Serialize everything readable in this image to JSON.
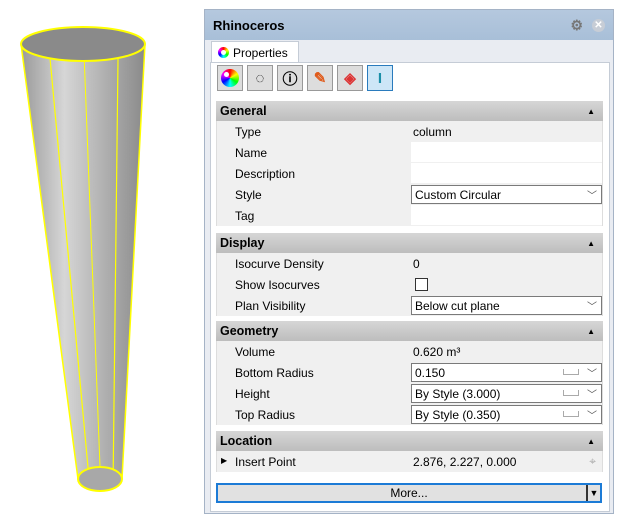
{
  "window": {
    "title": "Rhinoceros",
    "tab": "Properties"
  },
  "toolbar_icons": [
    "material-icon",
    "render-mesh-icon",
    "info-icon",
    "paint-tube-icon",
    "texture-mapping-icon",
    "column-icon"
  ],
  "sections": {
    "general": {
      "title": "General",
      "type_label": "Type",
      "type_value": "column",
      "name_label": "Name",
      "name_value": "",
      "desc_label": "Description",
      "desc_value": "",
      "style_label": "Style",
      "style_value": "Custom Circular",
      "tag_label": "Tag",
      "tag_value": ""
    },
    "display": {
      "title": "Display",
      "iso_label": "Isocurve Density",
      "iso_value": "0",
      "show_label": "Show Isocurves",
      "show_checked": false,
      "plan_label": "Plan Visibility",
      "plan_value": "Below cut plane"
    },
    "geometry": {
      "title": "Geometry",
      "volume_label": "Volume",
      "volume_value": "0.620 m³",
      "bottom_label": "Bottom Radius",
      "bottom_value": "0.150",
      "height_label": "Height",
      "height_value": "By Style (3.000)",
      "top_label": "Top Radius",
      "top_value": "By Style (0.350)"
    },
    "location": {
      "title": "Location",
      "insert_label": "Insert Point",
      "insert_value": "2.876, 2.227, 0.000"
    }
  },
  "more_button": "More...",
  "colors": {
    "highlight": "#ffff00",
    "accent": "#1c7bd6"
  }
}
